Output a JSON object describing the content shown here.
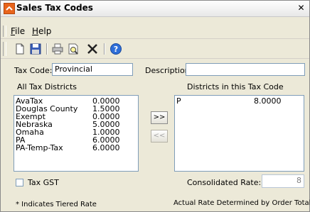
{
  "window": {
    "title": "Sales Tax Codes",
    "close_glyph": "✕"
  },
  "menu": [
    {
      "label": "File",
      "accel": "F",
      "rest": "ile"
    },
    {
      "label": "Help",
      "accel": "H",
      "rest": "elp"
    }
  ],
  "toolbar": {
    "buttons": [
      "new-icon",
      "save-icon",
      "print-icon",
      "print-preview-icon",
      "delete-icon",
      "help-icon"
    ]
  },
  "form": {
    "tax_code_label": "Tax Code:",
    "tax_code_value": "Provincial",
    "description_label": "Description:",
    "description_value": "",
    "all_districts_label": "All Tax Districts",
    "districts_in_code_label": "Districts in this Tax Code",
    "all_districts": [
      {
        "name": "AvaTax",
        "rate": "0.0000"
      },
      {
        "name": "Douglas County",
        "rate": "1.5000"
      },
      {
        "name": "Exempt",
        "rate": "0.0000"
      },
      {
        "name": "Nebraska",
        "rate": "5.0000"
      },
      {
        "name": "Omaha",
        "rate": "1.0000"
      },
      {
        "name": "PA",
        "rate": "6.0000"
      },
      {
        "name": "PA-Temp-Tax",
        "rate": "6.0000"
      }
    ],
    "selected_districts": [
      {
        "name": "P",
        "rate": "8.0000"
      }
    ],
    "add_button": ">>",
    "remove_button": "<<",
    "tax_gst_label": "Tax GST",
    "consolidated_rate_label": "Consolidated Rate:",
    "consolidated_rate_value": "8",
    "tiered_note": "* Indicates Tiered Rate",
    "rate_note": "Actual Rate Determined by Order Total"
  },
  "colors": {
    "accent": "#e8641c",
    "field_border": "#7f9db9",
    "window_bg": "#ece9d8"
  }
}
